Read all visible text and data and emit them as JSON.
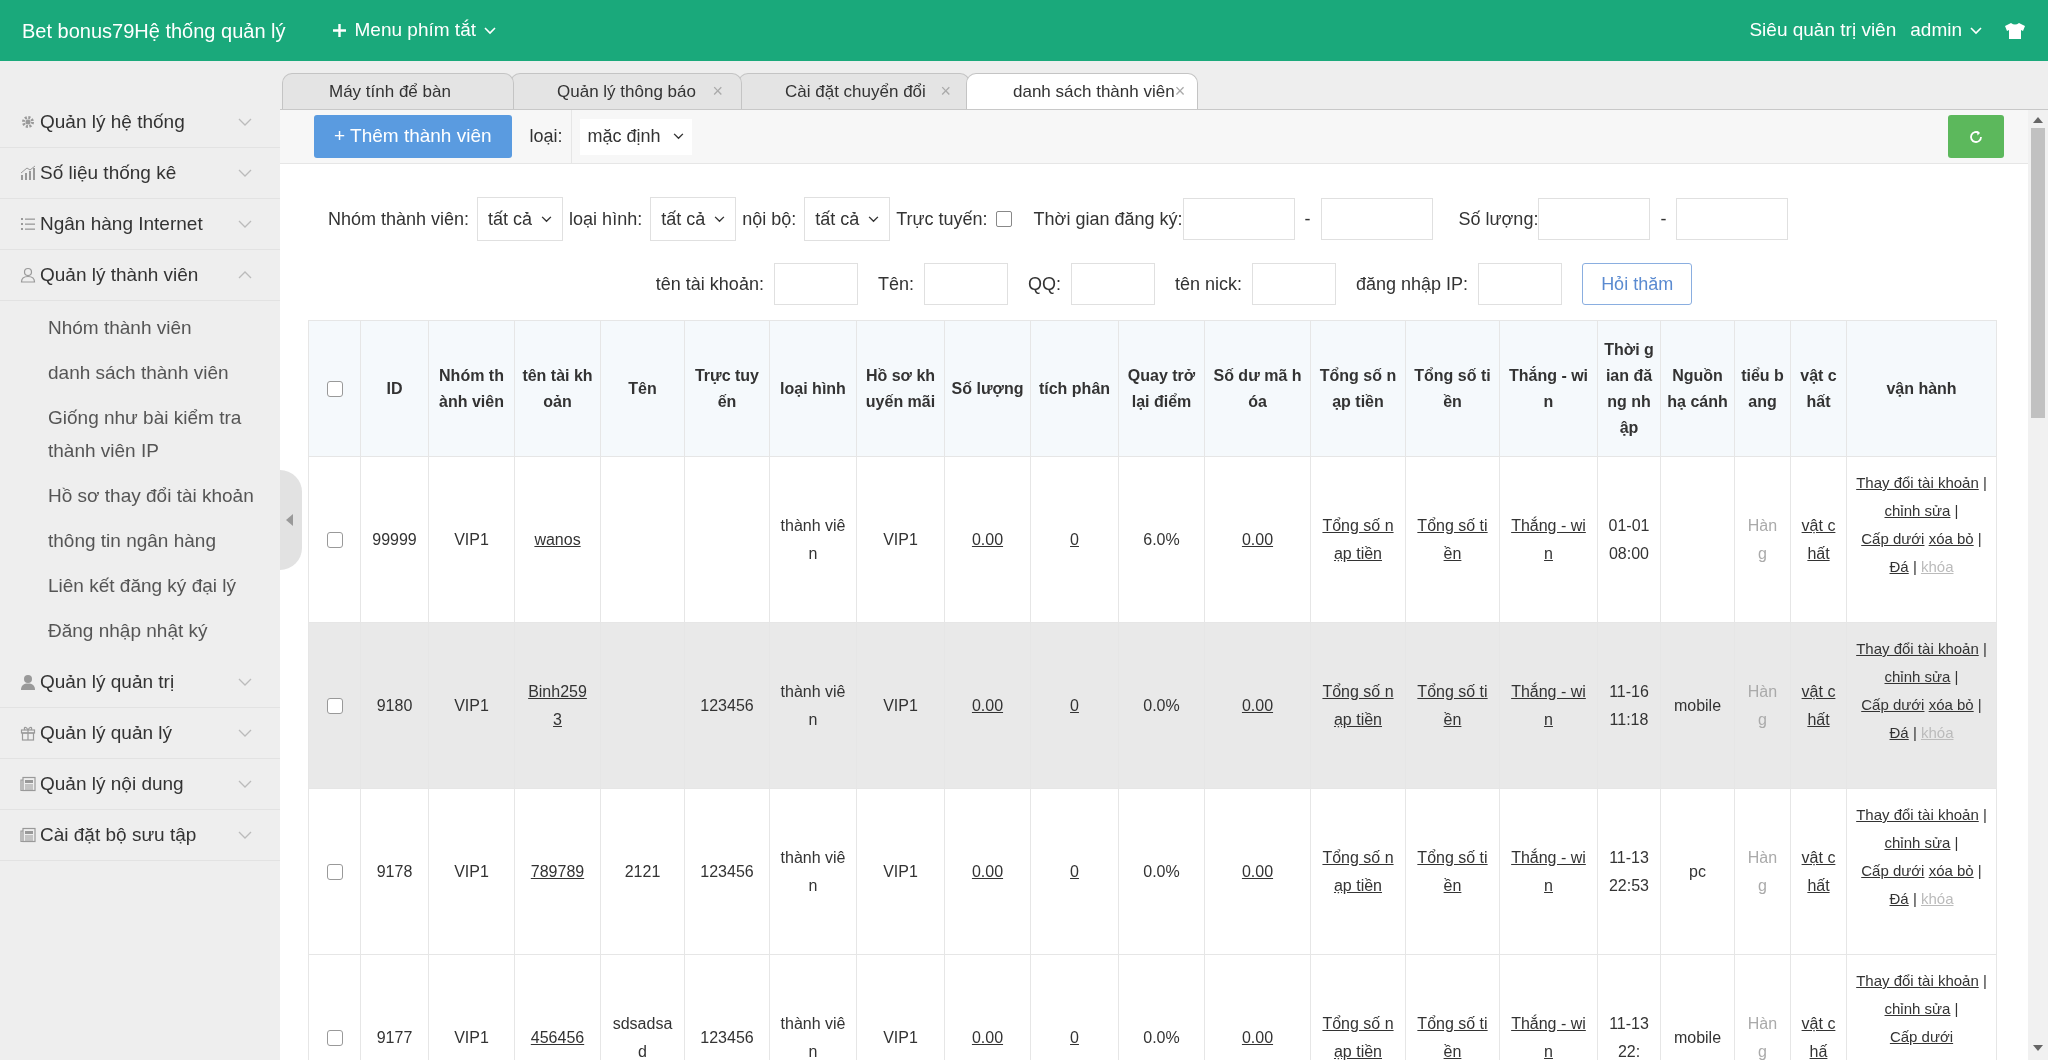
{
  "header": {
    "title": "Bet bonus79Hệ thống quản lý",
    "shortcut_menu": "Menu phím tắt",
    "role": "Siêu quản trị viên",
    "user": "admin"
  },
  "sidebar": {
    "items": [
      {
        "label": "Quản lý hệ thống",
        "expanded": false
      },
      {
        "label": "Số liệu thống kê",
        "expanded": false
      },
      {
        "label": "Ngân hàng Internet",
        "expanded": false
      },
      {
        "label": "Quản lý thành viên",
        "expanded": true,
        "children": [
          {
            "label": "Nhóm thành viên"
          },
          {
            "label": "danh sách thành viên"
          },
          {
            "label": "Giống như bài kiểm tra thành viên IP"
          },
          {
            "label": "Hồ sơ thay đổi tài khoản"
          },
          {
            "label": "thông tin ngân hàng"
          },
          {
            "label": "Liên kết đăng ký đại lý"
          },
          {
            "label": "Đăng nhập nhật ký"
          }
        ]
      },
      {
        "label": "Quản lý quản trị",
        "expanded": false
      },
      {
        "label": "Quản lý quản lý",
        "expanded": false
      },
      {
        "label": "Quản lý nội dung",
        "expanded": false
      },
      {
        "label": "Cài đặt bộ sưu tập",
        "expanded": false
      }
    ]
  },
  "tabs": [
    {
      "label": "Máy tính để bàn",
      "selected": false
    },
    {
      "label": "Quản lý thông báo",
      "close": "×",
      "selected": false
    },
    {
      "label": "Cài đặt chuyển đổi",
      "close": "×",
      "selected": false
    },
    {
      "label": "danh sách thành viên",
      "close": "×",
      "selected": true
    }
  ],
  "toolbar": {
    "add_button": "+ Thêm thành viên",
    "type_label": "loại:",
    "type_value": "mặc định"
  },
  "filters": {
    "row1": [
      {
        "kind": "select",
        "label": "Nhóm thành viên:",
        "value": "tất cả"
      },
      {
        "kind": "select",
        "label": "loại hình:",
        "value": "tất cả"
      },
      {
        "kind": "select",
        "label": "nội bộ:",
        "value": "tất cả"
      },
      {
        "kind": "checkbox",
        "label": "Trực tuyến:",
        "checked": false
      },
      {
        "kind": "range",
        "label": "Thời gian đăng ký:",
        "dash": "-"
      },
      {
        "kind": "range",
        "label": "Số lượng:",
        "dash": "-"
      }
    ],
    "row2": [
      {
        "label": "tên tài khoản:"
      },
      {
        "label": "Tên:"
      },
      {
        "label": "QQ:"
      },
      {
        "label": "tên nick:"
      },
      {
        "label": "đăng nhập IP:"
      }
    ],
    "search_button": "Hỏi thăm"
  },
  "table": {
    "header_checked": false,
    "columns": [
      "ID",
      "Nhóm thành viên",
      "tên tài khoản",
      "Tên",
      "Trực tuyến",
      "loại hình",
      "Hồ sơ khuyến mãi",
      "Số lượng",
      "tích phân",
      "Quay trở lại điểm",
      "Số dư mã hóa",
      "Tổng số nạp tiền",
      "Tổng số tiền",
      "Thắng - win",
      "Thời gian đăng nhập",
      "Nguồn hạ cánh",
      "tiểu bang",
      "vật chất",
      "vận hành"
    ],
    "rows": [
      {
        "checked": false,
        "highlighted": false,
        "cells": [
          {
            "kind": "text",
            "text": "99999"
          },
          {
            "kind": "text",
            "text": "VIP1"
          },
          {
            "kind": "link",
            "text": "wanos"
          },
          {
            "kind": "empty"
          },
          {
            "kind": "empty"
          },
          {
            "kind": "text",
            "text": "thành viên"
          },
          {
            "kind": "text",
            "text": "VIP1"
          },
          {
            "kind": "link",
            "text": "0.00"
          },
          {
            "kind": "link",
            "text": "0"
          },
          {
            "kind": "text",
            "text": "6.0%"
          },
          {
            "kind": "link",
            "text": "0.00"
          },
          {
            "kind": "link",
            "text": "Tổng số nạp tiền"
          },
          {
            "kind": "link",
            "text": "Tổng số tiền"
          },
          {
            "kind": "link",
            "text": "Thắng - win"
          },
          {
            "kind": "text",
            "text": "01-01 08:00"
          },
          {
            "kind": "empty"
          },
          {
            "kind": "muted",
            "text": "Hàng"
          },
          {
            "kind": "link",
            "text": "vật chất"
          },
          {
            "kind": "actions",
            "actions": [
              {
                "label": "Thay đổi tài khoản",
                "disabled": false,
                "sep": "|"
              },
              {
                "label": "chỉnh sửa",
                "disabled": false,
                "sep": "|"
              },
              {
                "label": "Cấp dưới",
                "disabled": false
              },
              {
                "label": "xóa bỏ",
                "disabled": false,
                "sep": "|"
              },
              {
                "label": "Đá",
                "disabled": false,
                "sep": "|"
              },
              {
                "label": "khóa",
                "disabled": true
              }
            ]
          }
        ]
      },
      {
        "checked": false,
        "highlighted": true,
        "cells": [
          {
            "kind": "text",
            "text": "9180"
          },
          {
            "kind": "text",
            "text": "VIP1"
          },
          {
            "kind": "link",
            "text": "Binh2593"
          },
          {
            "kind": "empty"
          },
          {
            "kind": "text",
            "text": "123456"
          },
          {
            "kind": "text",
            "text": "thành viên"
          },
          {
            "kind": "text",
            "text": "VIP1"
          },
          {
            "kind": "link",
            "text": "0.00"
          },
          {
            "kind": "link",
            "text": "0"
          },
          {
            "kind": "text",
            "text": "0.0%"
          },
          {
            "kind": "link",
            "text": "0.00"
          },
          {
            "kind": "link",
            "text": "Tổng số nạp tiền"
          },
          {
            "kind": "link",
            "text": "Tổng số tiền"
          },
          {
            "kind": "link",
            "text": "Thắng - win"
          },
          {
            "kind": "text",
            "text": "11-16 11:18"
          },
          {
            "kind": "text",
            "text": "mobile"
          },
          {
            "kind": "muted",
            "text": "Hàng"
          },
          {
            "kind": "link",
            "text": "vật chất"
          },
          {
            "kind": "actions",
            "actions": [
              {
                "label": "Thay đổi tài khoản",
                "disabled": false,
                "sep": "|"
              },
              {
                "label": "chỉnh sửa",
                "disabled": false,
                "sep": "|"
              },
              {
                "label": "Cấp dưới",
                "disabled": false
              },
              {
                "label": "xóa bỏ",
                "disabled": false,
                "sep": "|"
              },
              {
                "label": "Đá",
                "disabled": false,
                "sep": "|"
              },
              {
                "label": "khóa",
                "disabled": true
              }
            ]
          }
        ]
      },
      {
        "checked": false,
        "highlighted": false,
        "cells": [
          {
            "kind": "text",
            "text": "9178"
          },
          {
            "kind": "text",
            "text": "VIP1"
          },
          {
            "kind": "link",
            "text": "789789"
          },
          {
            "kind": "text",
            "text": "2121"
          },
          {
            "kind": "text",
            "text": "123456"
          },
          {
            "kind": "text",
            "text": "thành viên"
          },
          {
            "kind": "text",
            "text": "VIP1"
          },
          {
            "kind": "link",
            "text": "0.00"
          },
          {
            "kind": "link",
            "text": "0"
          },
          {
            "kind": "text",
            "text": "0.0%"
          },
          {
            "kind": "link",
            "text": "0.00"
          },
          {
            "kind": "link",
            "text": "Tổng số nạp tiền"
          },
          {
            "kind": "link",
            "text": "Tổng số tiền"
          },
          {
            "kind": "link",
            "text": "Thắng - win"
          },
          {
            "kind": "text",
            "text": "11-13 22:53"
          },
          {
            "kind": "text",
            "text": "pc"
          },
          {
            "kind": "muted",
            "text": "Hàng"
          },
          {
            "kind": "link",
            "text": "vật chất"
          },
          {
            "kind": "actions",
            "actions": [
              {
                "label": "Thay đổi tài khoản",
                "disabled": false,
                "sep": "|"
              },
              {
                "label": "chỉnh sửa",
                "disabled": false,
                "sep": "|"
              },
              {
                "label": "Cấp dưới",
                "disabled": false
              },
              {
                "label": "xóa bỏ",
                "disabled": false,
                "sep": "|"
              },
              {
                "label": "Đá",
                "disabled": false,
                "sep": "|"
              },
              {
                "label": "khóa",
                "disabled": true
              }
            ]
          }
        ]
      },
      {
        "checked": false,
        "highlighted": false,
        "cells": [
          {
            "kind": "text",
            "text": "9177"
          },
          {
            "kind": "text",
            "text": "VIP1"
          },
          {
            "kind": "link",
            "text": "456456"
          },
          {
            "kind": "text",
            "text": "sdsadsad"
          },
          {
            "kind": "text",
            "text": "123456"
          },
          {
            "kind": "text",
            "text": "thành viên"
          },
          {
            "kind": "text",
            "text": "VIP1"
          },
          {
            "kind": "link",
            "text": "0.00"
          },
          {
            "kind": "link",
            "text": "0"
          },
          {
            "kind": "text",
            "text": "0.0%"
          },
          {
            "kind": "link",
            "text": "0.00"
          },
          {
            "kind": "link",
            "text": "Tổng số nạp tiền"
          },
          {
            "kind": "link",
            "text": "Tổng số tiền"
          },
          {
            "kind": "link",
            "text": "Thắng - win"
          },
          {
            "kind": "text",
            "text": "11-13 22:"
          },
          {
            "kind": "text",
            "text": "mobile"
          },
          {
            "kind": "muted",
            "text": "Hàng"
          },
          {
            "kind": "link",
            "text": "vật chấ"
          },
          {
            "kind": "actions",
            "actions": [
              {
                "label": "Thay đổi tài khoản",
                "disabled": false,
                "sep": "|"
              },
              {
                "label": "chỉnh sửa",
                "disabled": false,
                "sep": "|"
              },
              {
                "label": "Cấp dưới",
                "disabled": false
              }
            ]
          }
        ]
      }
    ]
  }
}
